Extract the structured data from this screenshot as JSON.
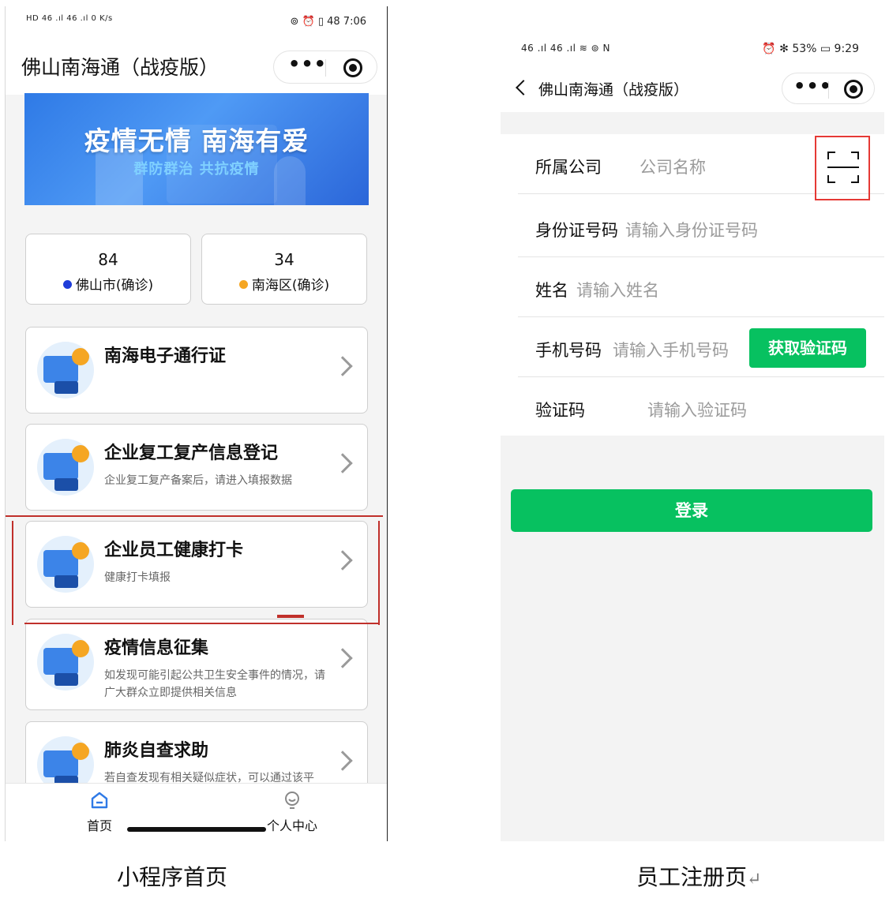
{
  "home": {
    "status": {
      "left": "HD 46 .ıl 46 .ıl  0 K/s",
      "right": "⊚ ⏰ ▯ 48  7:06"
    },
    "title": "佛山南海通（战疫版）",
    "capsule": {
      "more": "•••"
    },
    "banner": {
      "title": "疫情无情 南海有爱",
      "subtitle": "群防群治 共抗疫情"
    },
    "stats": [
      {
        "value": "84",
        "label": "佛山市(确诊)",
        "color": "#1f3dd9"
      },
      {
        "value": "34",
        "label": "南海区(确诊)",
        "color": "#f5a623"
      }
    ],
    "cards": [
      {
        "title": "南海电子通行证",
        "desc": "",
        "icon": "paper-plane-icon"
      },
      {
        "title": "企业复工复产信息登记",
        "desc": "企业复工复产备案后，请进入填报数据",
        "icon": "office-worker-icon"
      },
      {
        "title": "企业员工健康打卡",
        "desc": "健康打卡填报",
        "icon": "doctor-icon"
      },
      {
        "title": "疫情信息征集",
        "desc": "如发现可能引起公共卫生安全事件的情况，请广大群众立即提供相关信息",
        "icon": "pencil-checklist-icon"
      },
      {
        "title": "肺炎自查求助",
        "desc": "若自查发现有相关疑似症状，可以通过该平",
        "icon": "magnifier-doctor-icon"
      }
    ],
    "tabs": [
      {
        "label": "首页",
        "icon": "home-icon"
      },
      {
        "label": "个人中心",
        "icon": "user-icon"
      }
    ]
  },
  "register": {
    "status": {
      "left": "46 .ıl 46 .ıl ≋ ⊚ N",
      "right": "⏰ ✻ 53% ▭ 9:29"
    },
    "title": "佛山南海通（战疫版）",
    "capsule": {
      "more": "•••"
    },
    "fields": [
      {
        "label": "所属公司",
        "placeholder": "公司名称"
      },
      {
        "label": "身份证号码",
        "placeholder": "请输入身份证号码"
      },
      {
        "label": "姓名",
        "placeholder": "请输入姓名"
      },
      {
        "label": "手机号码",
        "placeholder": "请输入手机号码"
      },
      {
        "label": "验证码",
        "placeholder": "请输入验证码"
      }
    ],
    "get_code_label": "获取验证码",
    "login_label": "登录",
    "accent": "#07c160"
  },
  "captions": {
    "left": "小程序首页",
    "right": "员工注册页",
    "right_mark": "↵"
  }
}
